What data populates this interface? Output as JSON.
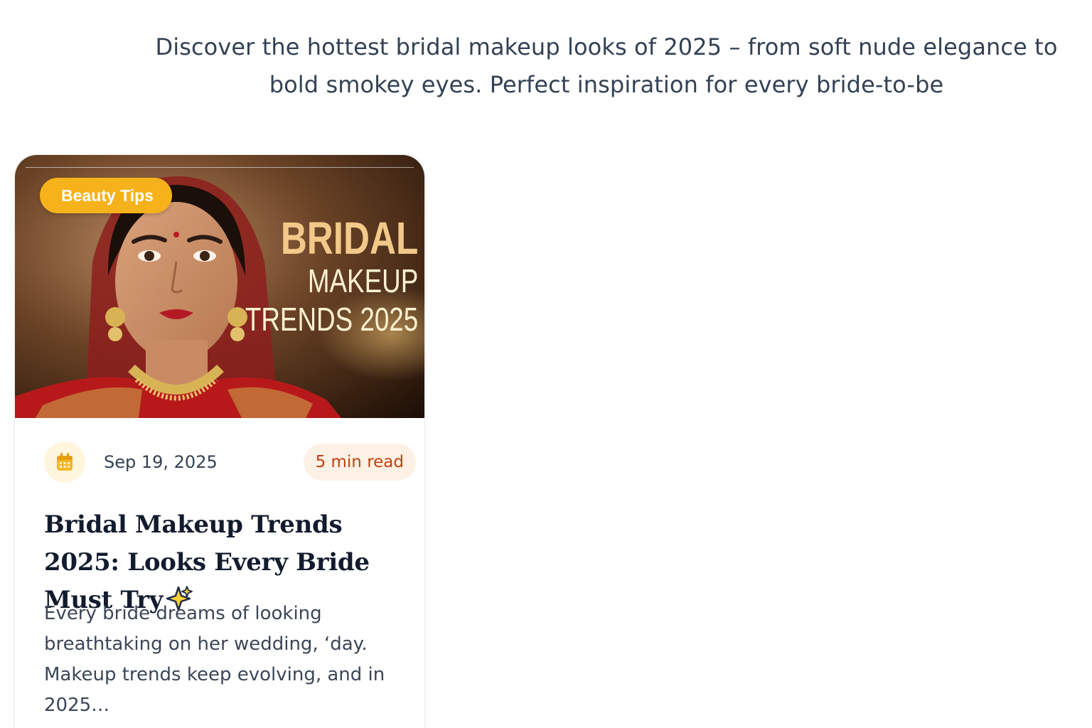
{
  "intro": {
    "text": "Discover the hottest bridal makeup looks of 2025 – from soft nude elegance to bold smokey eyes. Perfect inspiration for every bride-to-be"
  },
  "post": {
    "category": "Beauty Tips",
    "image": {
      "title_line1": "BRIDAL",
      "title_line2": "MAKEUP",
      "title_line3": "TRENDS 2025"
    },
    "date": "Sep 19, 2025",
    "read_time": "5 min read",
    "title": "Bridal Makeup Trends 2025: Looks Every Bride Must Try",
    "title_icon": "sparkles-icon",
    "excerpt": "Every bride dreams of looking breathtaking on her wedding, ‘day. Makeup trends keep evolving,  and in 2025…"
  },
  "colors": {
    "category_badge": "#f6b21a",
    "read_badge_bg": "#fdf1e6",
    "read_badge_text": "#c2410c",
    "title_text": "#131c2e",
    "body_text": "#334155"
  }
}
